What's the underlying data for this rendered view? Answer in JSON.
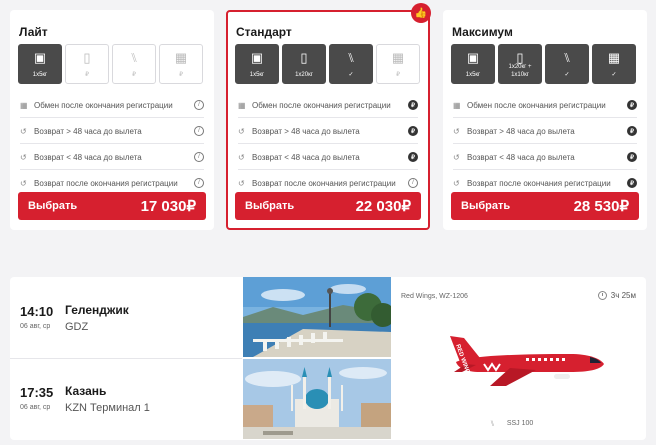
{
  "tariffs": [
    {
      "name": "Лайт",
      "selected": false,
      "features": [
        {
          "icon": "bag-icon",
          "glyph": "▣",
          "caption": "1x5кг",
          "included": true
        },
        {
          "icon": "suitcase-icon",
          "glyph": "▯",
          "caption": "₽",
          "included": false
        },
        {
          "icon": "seat-icon",
          "glyph": "⑊",
          "caption": "₽",
          "included": false
        },
        {
          "icon": "calendar-icon",
          "glyph": "▦",
          "caption": "₽",
          "included": false
        }
      ],
      "conditions": [
        {
          "icon": "calendar-small-icon",
          "text": "Обмен после окончания регистрации",
          "status": "not-allowed"
        },
        {
          "icon": "return-icon",
          "text": "Возврат > 48 часа до вылета",
          "status": "not-allowed"
        },
        {
          "icon": "return-icon",
          "text": "Возврат < 48 часа до вылета",
          "status": "not-allowed"
        },
        {
          "icon": "return-icon",
          "text": "Возврат после окончания регистрации",
          "status": "not-allowed"
        }
      ],
      "button_label": "Выбрать",
      "price": "17 030₽"
    },
    {
      "name": "Стандарт",
      "selected": true,
      "badge_icon": "thumbs-up-icon",
      "features": [
        {
          "icon": "bag-icon",
          "glyph": "▣",
          "caption": "1x5кг",
          "included": true
        },
        {
          "icon": "suitcase-icon",
          "glyph": "▯",
          "caption": "1x20кг",
          "included": true
        },
        {
          "icon": "seat-icon",
          "glyph": "⑊",
          "caption": "✓",
          "included": true
        },
        {
          "icon": "calendar-icon",
          "glyph": "▦",
          "caption": "₽",
          "included": false
        }
      ],
      "conditions": [
        {
          "icon": "calendar-small-icon",
          "text": "Обмен после окончания регистрации",
          "status": "paid"
        },
        {
          "icon": "return-icon",
          "text": "Возврат > 48 часа до вылета",
          "status": "paid"
        },
        {
          "icon": "return-icon",
          "text": "Возврат < 48 часа до вылета",
          "status": "paid"
        },
        {
          "icon": "return-icon",
          "text": "Возврат после окончания регистрации",
          "status": "not-allowed"
        }
      ],
      "button_label": "Выбрать",
      "price": "22 030₽"
    },
    {
      "name": "Максимум",
      "selected": false,
      "features": [
        {
          "icon": "bag-icon",
          "glyph": "▣",
          "caption": "1x5кг",
          "included": true
        },
        {
          "icon": "suitcase-icon",
          "glyph": "▯",
          "caption": "1x20кг + 1x10кг",
          "included": true
        },
        {
          "icon": "seat-icon",
          "glyph": "⑊",
          "caption": "✓",
          "included": true
        },
        {
          "icon": "calendar-icon",
          "glyph": "▦",
          "caption": "✓",
          "included": true
        }
      ],
      "conditions": [
        {
          "icon": "calendar-small-icon",
          "text": "Обмен после окончания регистрации",
          "status": "paid"
        },
        {
          "icon": "return-icon",
          "text": "Возврат > 48 часа до вылета",
          "status": "paid"
        },
        {
          "icon": "return-icon",
          "text": "Возврат < 48 часа до вылета",
          "status": "paid"
        },
        {
          "icon": "return-icon",
          "text": "Возврат после окончания регистрации",
          "status": "paid"
        }
      ],
      "button_label": "Выбрать",
      "price": "28 530₽"
    }
  ],
  "flight": {
    "departure": {
      "time": "14:10",
      "date": "06 авг, ср",
      "city": "Геленджик",
      "code": "GDZ"
    },
    "arrival": {
      "time": "17:35",
      "date": "06 авг, ср",
      "city": "Казань",
      "code": "KZN Терминал 1"
    },
    "airline": "Red Wings, WZ-1206",
    "duration": "3ч 25м",
    "aircraft": "SSJ 100",
    "brand_color": "#d6202f"
  }
}
